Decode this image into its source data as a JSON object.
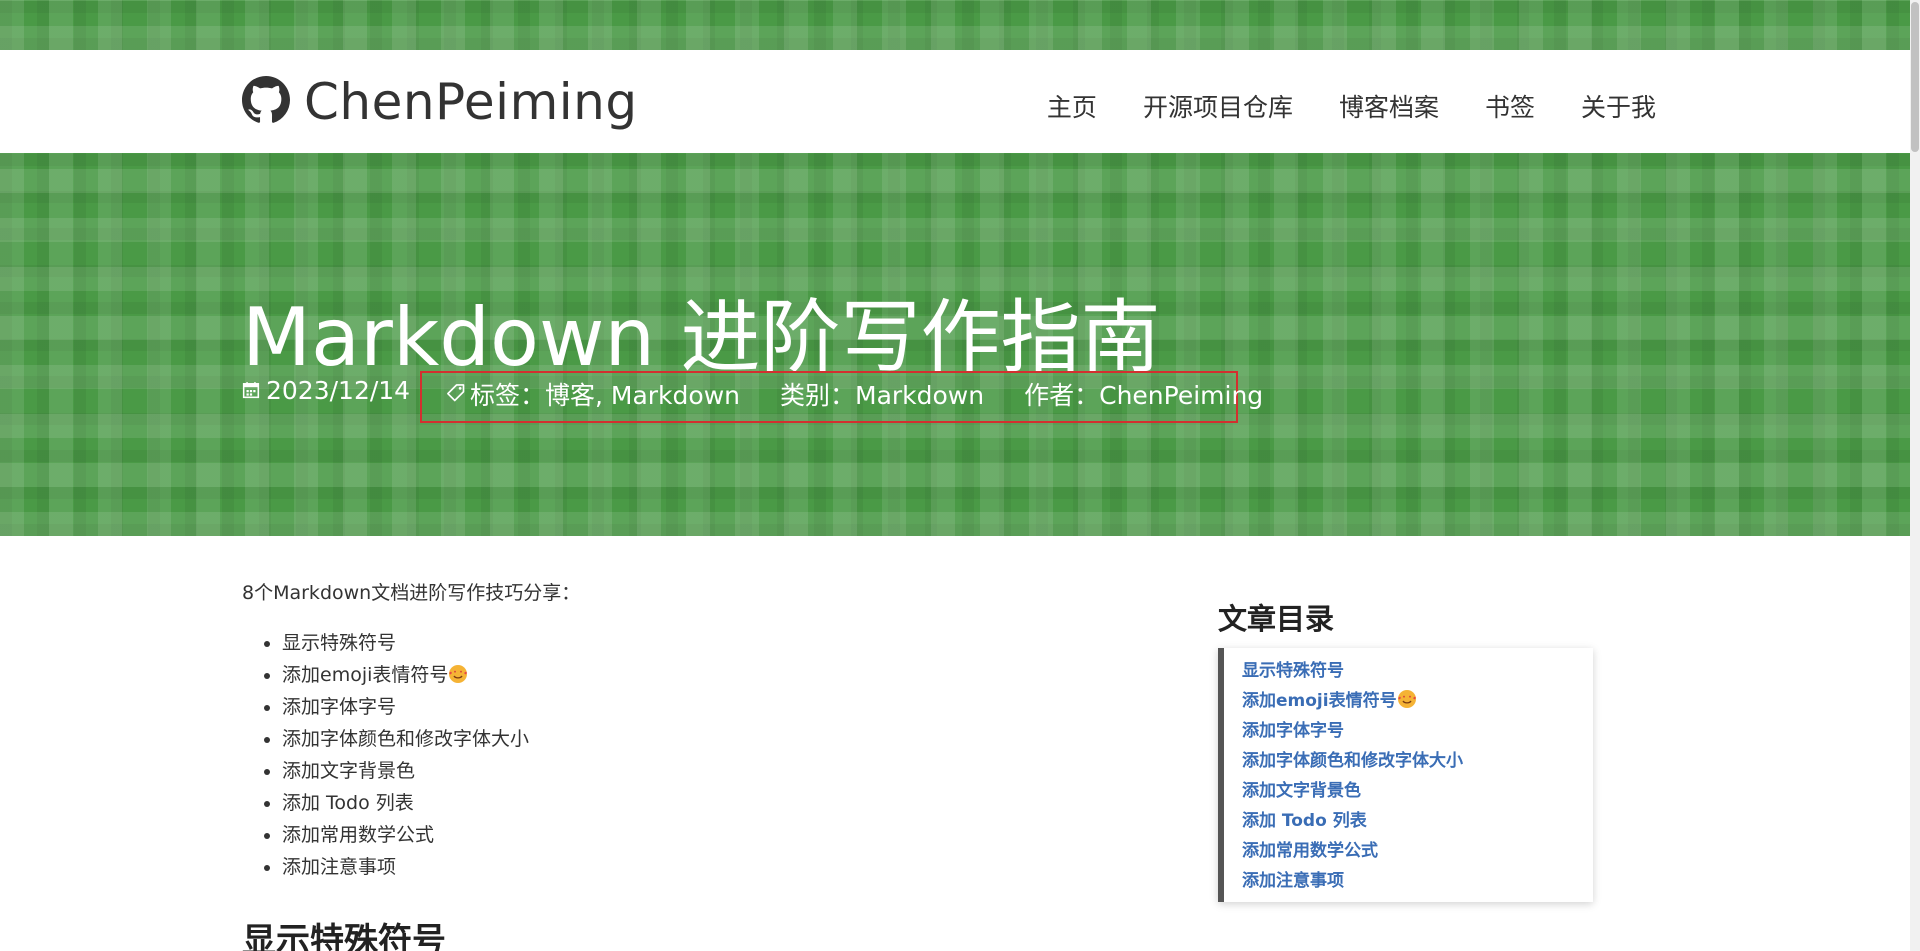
{
  "brand": {
    "name": "ChenPeiming",
    "icon": "github-icon"
  },
  "nav": {
    "items": [
      "主页",
      "开源项目仓库",
      "博客档案",
      "书签",
      "关于我"
    ]
  },
  "post": {
    "title": "Markdown 进阶写作指南",
    "date": "2023/12/14",
    "tags": "标签：博客, Markdown",
    "category": "类别：Markdown",
    "author": "作者：ChenPeiming"
  },
  "content": {
    "intro": "8个Markdown文档进阶写作技巧分享：",
    "list": [
      "显示特殊符号",
      "添加emoji表情符号",
      "添加字体字号",
      "添加字体颜色和修改字体大小",
      "添加文字背景色",
      "添加 Todo 列表",
      "添加常用数学公式",
      "添加注意事项"
    ],
    "section_heading": "显示特殊符号"
  },
  "sidebar": {
    "title": "文章目录",
    "links": [
      "显示特殊符号",
      "添加emoji表情符号",
      "添加字体字号",
      "添加字体颜色和修改字体大小",
      "添加文字背景色",
      "添加 Todo 列表",
      "添加常用数学公式",
      "添加注意事项"
    ]
  },
  "colors": {
    "hero_green": "#4a9a46",
    "link_blue": "#3a6db5",
    "highlight_red": "#d32f2f"
  }
}
